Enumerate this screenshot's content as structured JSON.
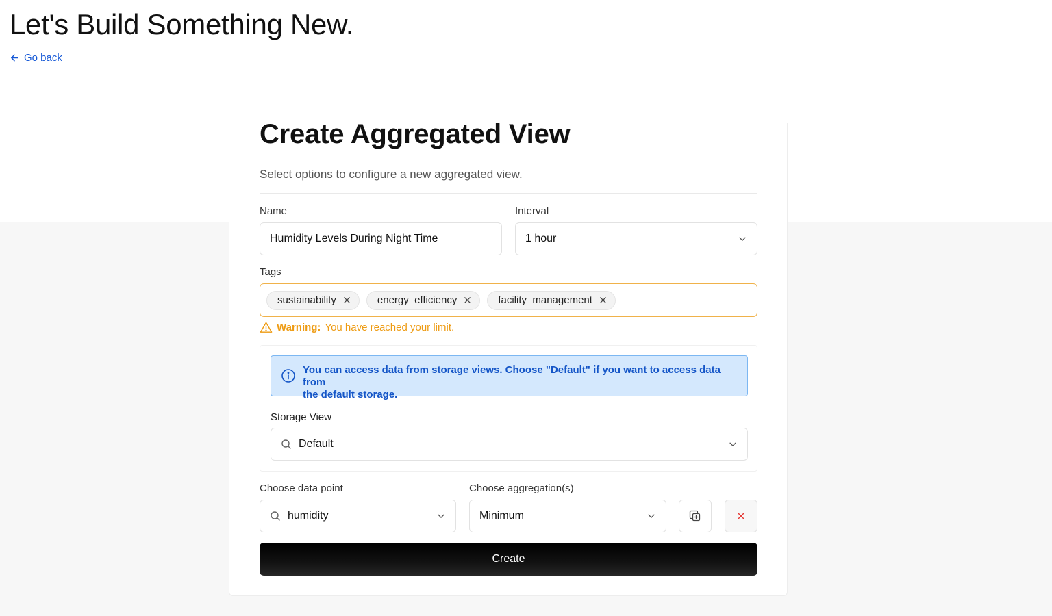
{
  "header": {
    "title": "Let's Build Something New.",
    "go_back": "Go back"
  },
  "form": {
    "title": "Create Aggregated View",
    "subtitle": "Select options to configure a new aggregated view.",
    "name": {
      "label": "Name",
      "value": "Humidity Levels During Night Time"
    },
    "interval": {
      "label": "Interval",
      "value": "1 hour"
    },
    "tags": {
      "label": "Tags",
      "items": [
        "sustainability",
        "energy_efficiency",
        "facility_management"
      ],
      "warning_prefix": "Warning:",
      "warning_text": "You have reached your limit."
    },
    "storage": {
      "info_line1": "You can access data from storage views. Choose \"Default\" if you want to access data from",
      "info_line2": "the default storage.",
      "label": "Storage View",
      "value": "Default"
    },
    "data_point": {
      "label": "Choose data point",
      "value": "humidity"
    },
    "aggregation": {
      "label": "Choose aggregation(s)",
      "value": "Minimum"
    },
    "create_label": "Create"
  },
  "colors": {
    "warning": "#ee9b12",
    "info_bg": "#d4e8fd",
    "info_text": "#1455c7",
    "link": "#1558d6",
    "delete": "#e53935"
  }
}
